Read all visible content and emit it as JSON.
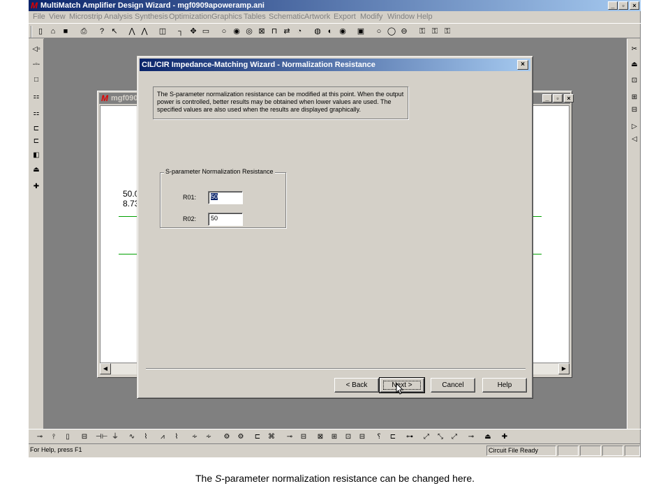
{
  "app": {
    "logo": "M",
    "title": "MultiMatch Amplifier Design Wizard - mgf0909apoweramp.ani",
    "window_buttons": [
      "_",
      "▫",
      "×"
    ]
  },
  "menu": [
    "File",
    "View",
    "Microstrip",
    "Analysis",
    "Synthesis",
    "Optimization",
    "Graphics",
    "Tables",
    "Schematic",
    "Artwork",
    "Export",
    "Modify",
    "Window",
    "Help"
  ],
  "child_window": {
    "logo": "M",
    "title": "mgf0909",
    "canvas_text_1": "50.0",
    "canvas_text_2": "8.73"
  },
  "dialog": {
    "title": "CIL/CIR Impedance-Matching Wizard - Normalization Resistance",
    "close": "×",
    "info": "The S-parameter normalization resistance  can be modified at this point. When the output power is controlled, better results may be obtained  when lower values are used. The specified values are also used when the results are displayed  graphically.",
    "group_title": "S-parameter Normalization Resistance",
    "r01_label": "R01:",
    "r01_value": "50",
    "r02_label": "R02:",
    "r02_value": "50",
    "buttons": {
      "back": "< Back",
      "next": "Next >",
      "cancel": "Cancel",
      "help": "Help"
    }
  },
  "status": {
    "help": "For Help, press F1",
    "file": "Circuit File Ready"
  },
  "caption": {
    "before": "The ",
    "italic": "S",
    "after": "-parameter normalization resistance can be changed here."
  }
}
